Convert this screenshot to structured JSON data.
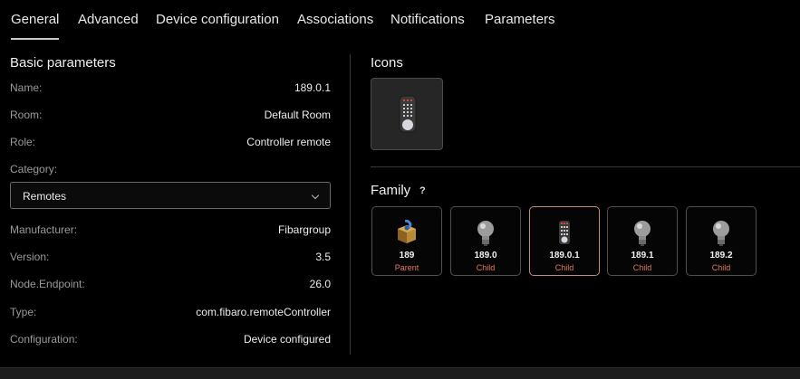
{
  "tabs": [
    "General",
    "Advanced",
    "Device configuration",
    "Associations",
    "Notifications",
    "Parameters"
  ],
  "basic": {
    "title": "Basic parameters",
    "name_label": "Name:",
    "name_value": "189.0.1",
    "room_label": "Room:",
    "room_value": "Default Room",
    "role_label": "Role:",
    "role_value": "Controller remote",
    "category_label": "Category:",
    "category_value": "Remotes",
    "manufacturer_label": "Manufacturer:",
    "manufacturer_value": "Fibargroup",
    "version_label": "Version:",
    "version_value": "3.5",
    "endpoint_label": "Node.Endpoint:",
    "endpoint_value": "26.0",
    "type_label": "Type:",
    "type_value": "com.fibaro.remoteController",
    "configuration_label": "Configuration:",
    "configuration_value": "Device configured"
  },
  "icons": {
    "title": "Icons"
  },
  "family": {
    "title": "Family",
    "help": "?",
    "items": [
      {
        "id": "189",
        "role": "Parent",
        "icon": "package-icon"
      },
      {
        "id": "189.0",
        "role": "Child",
        "icon": "bulb-icon"
      },
      {
        "id": "189.0.1",
        "role": "Child",
        "icon": "remote-icon"
      },
      {
        "id": "189.1",
        "role": "Child",
        "icon": "bulb-icon"
      },
      {
        "id": "189.2",
        "role": "Child",
        "icon": "bulb-icon"
      }
    ]
  },
  "colors": {
    "selected_border": "#c48a7a",
    "role_text": "#e07a63"
  }
}
